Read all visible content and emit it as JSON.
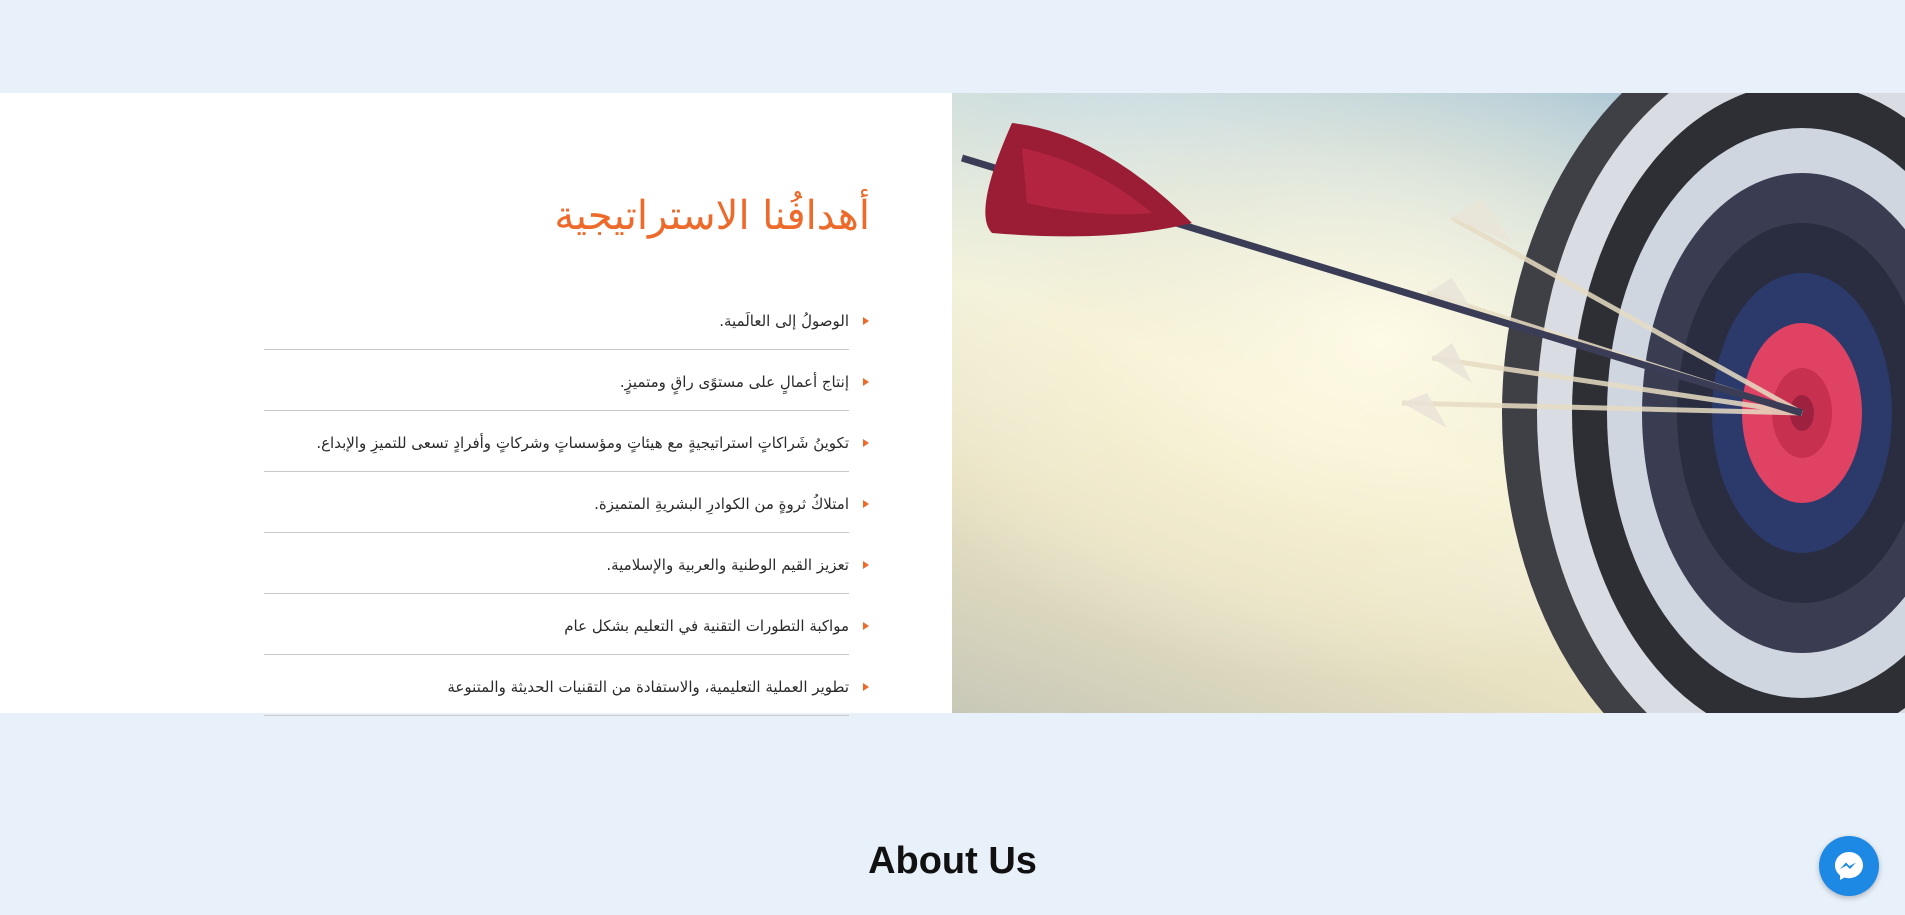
{
  "goals": {
    "title": "أهدافُنا الاستراتيجية",
    "items": [
      "الوصولُ إلى العالَمية.",
      "إنتاج أعمالٍ على مستوًى راقٍ ومتميزٍ.",
      "تكوينُ شَراكاتٍ استراتيجيةٍ مع هيئاتٍ ومؤسساتٍ وشركاتٍ وأفرادٍ تسعى للتميزِ والإبداع.",
      "امتلاكُ ثروةٍ من الكوادرِ البشريةِ المتميزة.",
      "تعزيز القيم الوطنية والعربية والإسلامية.",
      "مواكبة التطورات التقنية في التعليم بشكل عام",
      "تطوير العملية التعليمية، والاستفادة من التقنيات الحديثة والمتنوعة"
    ]
  },
  "about": {
    "title": "About Us"
  },
  "image": {
    "subject": "archery-target-with-arrows"
  },
  "messenger": {
    "icon": "messenger-icon"
  },
  "colors": {
    "accent": "#ee6a2a",
    "background": "#e8f0fa",
    "messenger": "#1e88e5"
  }
}
